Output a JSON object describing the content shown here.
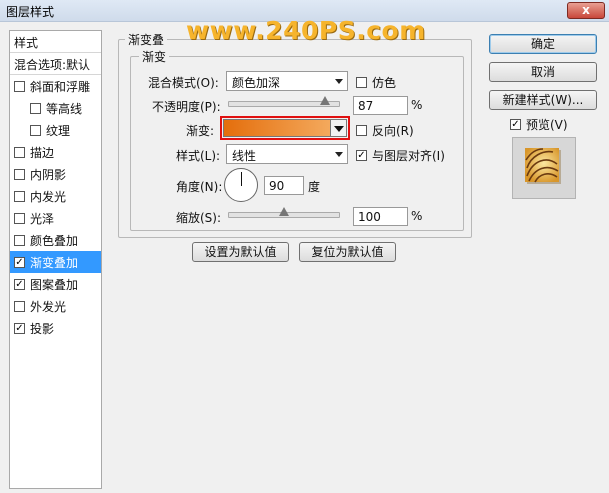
{
  "window": {
    "title": "图层样式",
    "close_glyph": "x"
  },
  "watermark": "www.240PS.com",
  "left_panel": {
    "header": "样式",
    "blend_header": "混合选项:默认",
    "items": [
      {
        "label": "斜面和浮雕",
        "checked": false,
        "sub": false,
        "selected": false
      },
      {
        "label": "等高线",
        "checked": false,
        "sub": true,
        "selected": false
      },
      {
        "label": "纹理",
        "checked": false,
        "sub": true,
        "selected": false
      },
      {
        "label": "描边",
        "checked": false,
        "sub": false,
        "selected": false
      },
      {
        "label": "内阴影",
        "checked": false,
        "sub": false,
        "selected": false
      },
      {
        "label": "内发光",
        "checked": false,
        "sub": false,
        "selected": false
      },
      {
        "label": "光泽",
        "checked": false,
        "sub": false,
        "selected": false
      },
      {
        "label": "颜色叠加",
        "checked": false,
        "sub": false,
        "selected": false
      },
      {
        "label": "渐变叠加",
        "checked": true,
        "sub": false,
        "selected": true
      },
      {
        "label": "图案叠加",
        "checked": true,
        "sub": false,
        "selected": false
      },
      {
        "label": "外发光",
        "checked": false,
        "sub": false,
        "selected": false
      },
      {
        "label": "投影",
        "checked": true,
        "sub": false,
        "selected": false
      }
    ]
  },
  "panel": {
    "outer_legend": "渐变叠",
    "inner_legend": "渐变",
    "blend_mode": {
      "label": "混合模式(O):",
      "value": "颜色加深"
    },
    "dither": {
      "label": "仿色",
      "checked": false
    },
    "opacity": {
      "label": "不透明度(P):",
      "value": "87",
      "unit": "%",
      "fraction": 0.87
    },
    "gradient": {
      "label": "渐变:",
      "color_start": "#e46e0c",
      "color_end": "#f6b269"
    },
    "reverse": {
      "label": "反向(R)",
      "checked": false
    },
    "style": {
      "label": "样式(L):",
      "value": "线性"
    },
    "align": {
      "label": "与图层对齐(I)",
      "checked": true
    },
    "angle": {
      "label": "角度(N):",
      "value": "90",
      "unit": "度"
    },
    "scale": {
      "label": "缩放(S):",
      "value": "100",
      "unit": "%",
      "fraction": 0.5
    },
    "set_default": "设置为默认值",
    "reset_default": "复位为默认值"
  },
  "actions": {
    "ok": "确定",
    "cancel": "取消",
    "new_style": "新建样式(W)...",
    "preview": {
      "label": "预览(V)",
      "checked": true
    }
  },
  "colors": {
    "selection": "#3399ff",
    "highlight_border": "#e01010"
  }
}
